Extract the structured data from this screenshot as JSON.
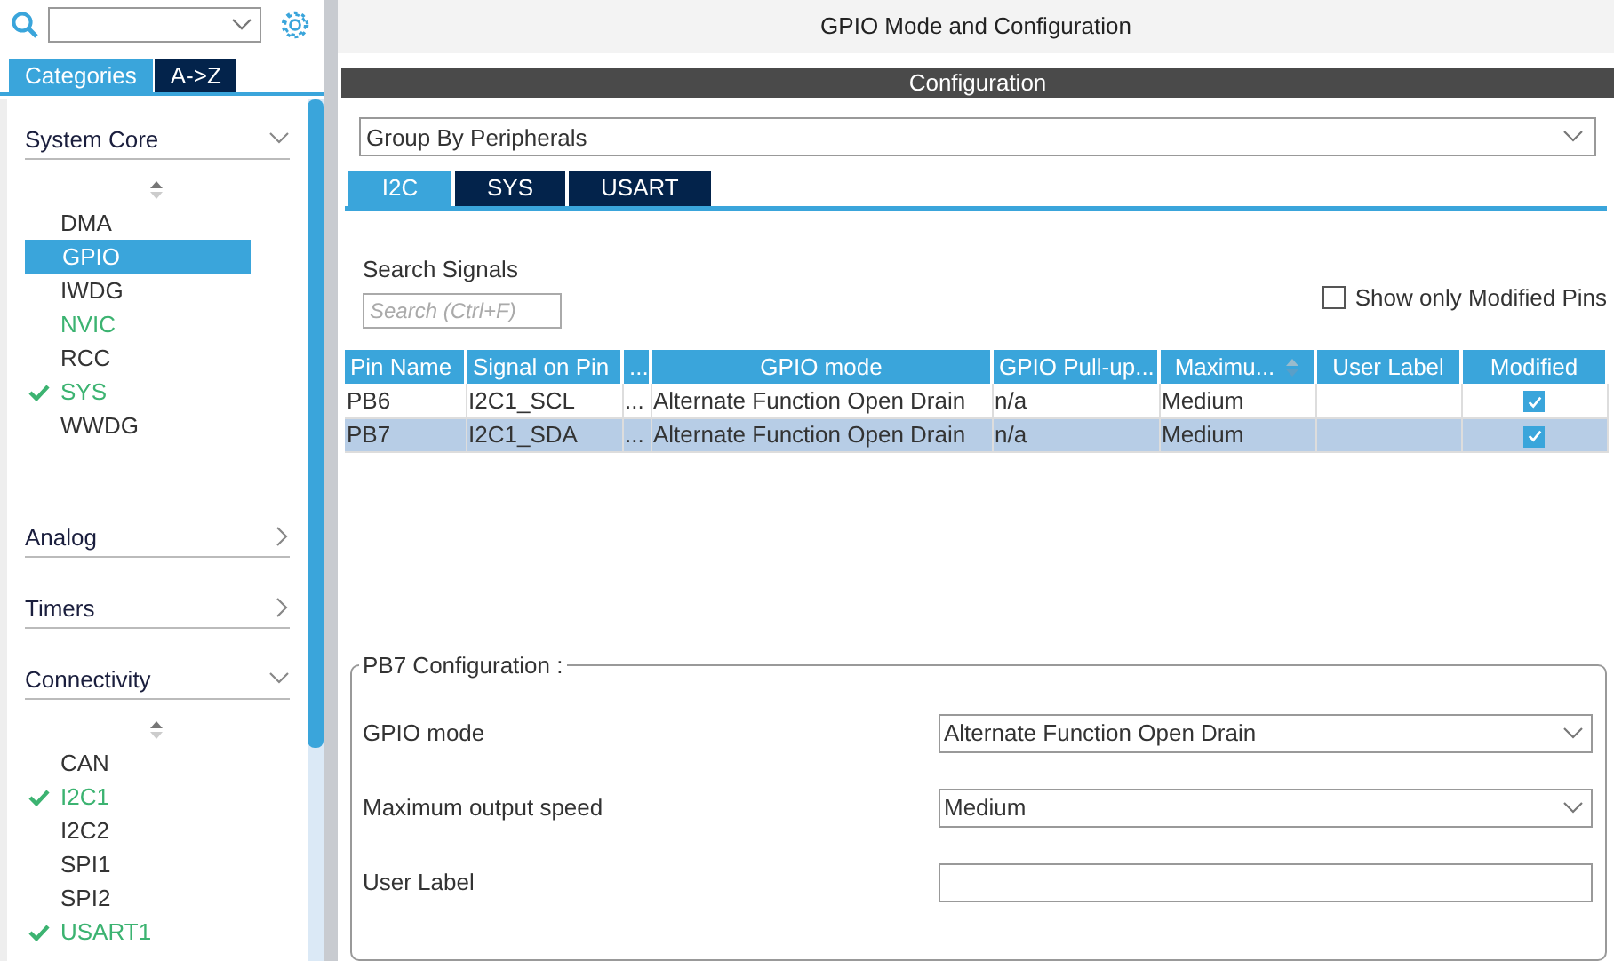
{
  "sidebar": {
    "tabs": [
      {
        "label": "Categories",
        "selected": true
      },
      {
        "label": "A->Z",
        "selected": false
      }
    ],
    "sections": [
      {
        "title": "System Core",
        "expanded": true,
        "items": [
          {
            "label": "DMA",
            "selected": false,
            "checked": false,
            "enabled": false
          },
          {
            "label": "GPIO",
            "selected": true,
            "checked": false,
            "enabled": false
          },
          {
            "label": "IWDG",
            "selected": false,
            "checked": false,
            "enabled": false
          },
          {
            "label": "NVIC",
            "selected": false,
            "checked": false,
            "enabled": true
          },
          {
            "label": "RCC",
            "selected": false,
            "checked": false,
            "enabled": false
          },
          {
            "label": "SYS",
            "selected": false,
            "checked": true,
            "enabled": true
          },
          {
            "label": "WWDG",
            "selected": false,
            "checked": false,
            "enabled": false
          }
        ]
      },
      {
        "title": "Analog",
        "expanded": false
      },
      {
        "title": "Timers",
        "expanded": false
      },
      {
        "title": "Connectivity",
        "expanded": true,
        "items": [
          {
            "label": "CAN",
            "selected": false,
            "checked": false,
            "enabled": false
          },
          {
            "label": "I2C1",
            "selected": false,
            "checked": true,
            "enabled": true
          },
          {
            "label": "I2C2",
            "selected": false,
            "checked": false,
            "enabled": false
          },
          {
            "label": "SPI1",
            "selected": false,
            "checked": false,
            "enabled": false
          },
          {
            "label": "SPI2",
            "selected": false,
            "checked": false,
            "enabled": false
          },
          {
            "label": "USART1",
            "selected": false,
            "checked": true,
            "enabled": true
          }
        ]
      }
    ]
  },
  "main": {
    "title": "GPIO Mode and Configuration",
    "section_title": "Configuration",
    "group_by": {
      "value": "Group By Peripherals"
    },
    "tabs": [
      {
        "label": "I2C",
        "selected": true
      },
      {
        "label": "SYS",
        "selected": false
      },
      {
        "label": "USART",
        "selected": false
      }
    ],
    "search_label": "Search Signals",
    "search": {
      "placeholder": "Search (Ctrl+F)"
    },
    "show_modified": {
      "label": "Show only Modified Pins",
      "checked": false
    },
    "table": {
      "columns": [
        "Pin Name",
        "Signal on Pin",
        "...",
        "GPIO mode",
        "GPIO Pull-up...",
        "Maximu...",
        "User Label",
        "Modified"
      ],
      "rows": [
        {
          "cells": [
            "PB6",
            "I2C1_SCL",
            "...",
            "Alternate Function Open Drain",
            "n/a",
            "Medium",
            ""
          ],
          "modified": true,
          "selected": false
        },
        {
          "cells": [
            "PB7",
            "I2C1_SDA",
            "...",
            "Alternate Function Open Drain",
            "n/a",
            "Medium",
            ""
          ],
          "modified": true,
          "selected": true
        }
      ]
    },
    "config": {
      "title": "PB7 Configuration :",
      "fields": [
        {
          "label": "GPIO mode",
          "kind": "select",
          "value": "Alternate Function Open Drain"
        },
        {
          "label": "Maximum output speed",
          "kind": "select",
          "value": "Medium"
        },
        {
          "label": "User Label",
          "kind": "text"
        }
      ]
    }
  }
}
